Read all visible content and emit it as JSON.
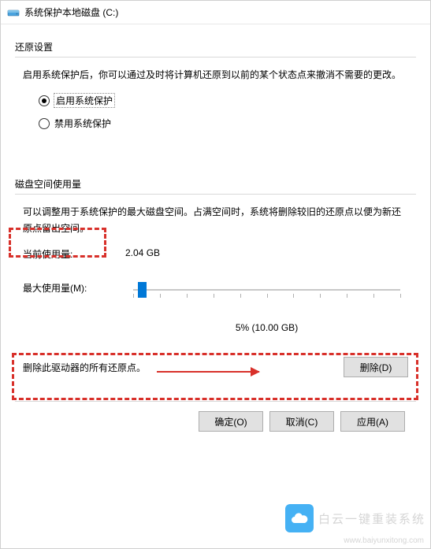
{
  "window": {
    "title": "系统保护本地磁盘 (C:)",
    "icon_name": "drive-icon"
  },
  "restore": {
    "group_label": "还原设置",
    "description": "启用系统保护后，你可以通过及时将计算机还原到以前的某个状态点来撤消不需要的更改。",
    "options": {
      "enable": "启用系统保护",
      "disable": "禁用系统保护"
    },
    "selected": "enable"
  },
  "disk": {
    "group_label": "磁盘空间使用量",
    "description": "可以调整用于系统保护的最大磁盘空间。占满空间时，系统将删除较旧的还原点以便为新还原点留出空间。",
    "current_label": "当前使用量:",
    "current_value": "2.04 GB",
    "max_label": "最大使用量(M):",
    "slider_percent": 5,
    "slider_display": "5% (10.00 GB)"
  },
  "delete": {
    "text": "删除此驱动器的所有还原点。",
    "button": "删除(D)"
  },
  "footer": {
    "ok": "确定(O)",
    "cancel": "取消(C)",
    "apply": "应用(A)"
  },
  "watermark": {
    "text": "白云一键重装系统",
    "url": "www.baiyunxitong.com"
  },
  "annotation": {
    "box1": "highlight-disk-label",
    "box2": "highlight-slider",
    "arrow": "slider-direction-arrow"
  },
  "colors": {
    "accent": "#0078d7",
    "highlight": "#d8302a"
  }
}
